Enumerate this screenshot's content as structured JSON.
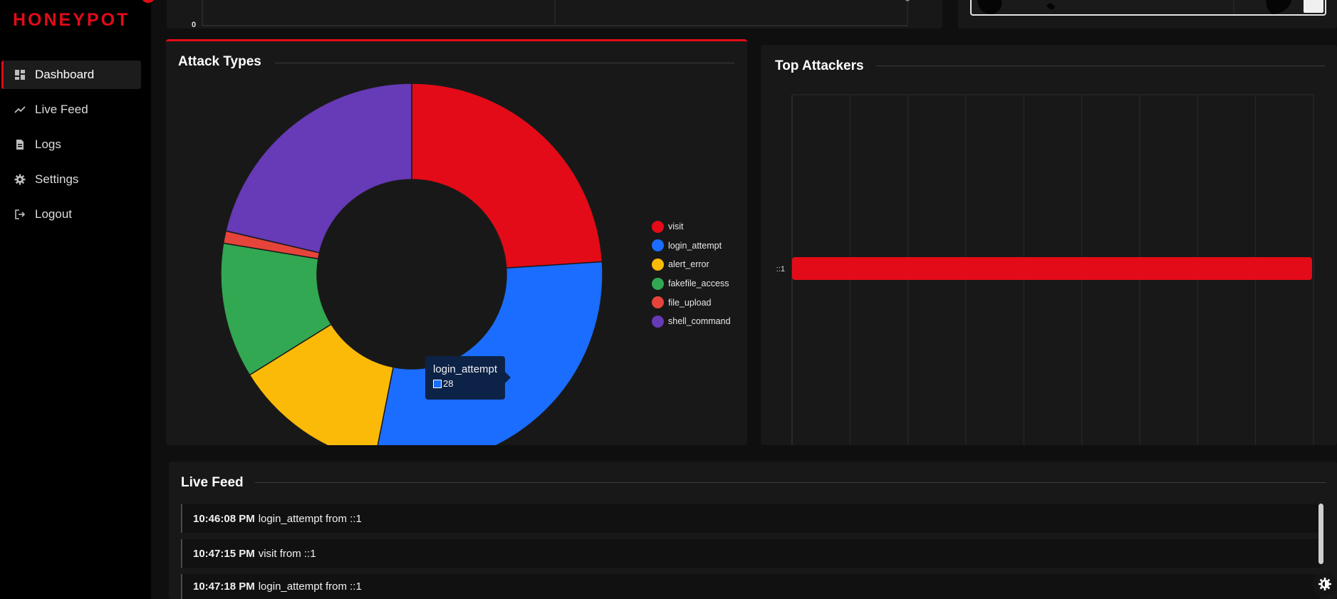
{
  "brand": {
    "name": "HONEYPOT",
    "color": "#e30b17"
  },
  "sidebar": {
    "items": [
      {
        "label": "Dashboard",
        "icon": "dashboard-icon",
        "active": true
      },
      {
        "label": "Live Feed",
        "icon": "trend-line-icon",
        "active": false
      },
      {
        "label": "Logs",
        "icon": "document-icon",
        "active": false
      },
      {
        "label": "Settings",
        "icon": "gear-icon",
        "active": false
      },
      {
        "label": "Logout",
        "icon": "logout-icon",
        "active": false
      }
    ]
  },
  "top_chart": {
    "axis_zero": "0"
  },
  "attack_types": {
    "title": "Attack Types",
    "tooltip": {
      "label": "login_attempt",
      "value": "28"
    }
  },
  "top_attackers": {
    "title": "Top Attackers"
  },
  "live_feed": {
    "title": "Live Feed",
    "entries": [
      {
        "time": "10:46:08 PM",
        "text": "login_attempt from ::1"
      },
      {
        "time": "10:47:15 PM",
        "text": "visit from ::1"
      },
      {
        "time": "10:47:18 PM",
        "text": "login_attempt from ::1"
      }
    ]
  },
  "colors": {
    "accent": "#e30b17",
    "visit": "#e30b17",
    "login_attempt": "#1a6dfe",
    "alert_error": "#fbba07",
    "fakefile_access": "#32a852",
    "file_upload": "#e6443a",
    "shell_command": "#673ab7"
  },
  "chart_data": [
    {
      "type": "pie",
      "title": "Attack Types",
      "categories": [
        "visit",
        "login_attempt",
        "alert_error",
        "fakefile_access",
        "file_upload",
        "shell_command"
      ],
      "values": [
        23,
        28,
        12.5,
        11,
        1,
        20.5
      ],
      "colors": [
        "#e30b17",
        "#1a6dfe",
        "#fbba07",
        "#32a852",
        "#e6443a",
        "#673ab7"
      ],
      "legend": "right",
      "donut": true
    },
    {
      "type": "bar",
      "orientation": "horizontal",
      "title": "Top Attackers",
      "categories": [
        "::1"
      ],
      "values": [
        1
      ],
      "grid": true,
      "color": "#e30b17"
    }
  ]
}
